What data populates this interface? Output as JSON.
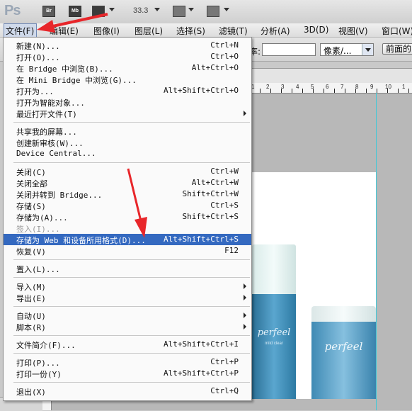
{
  "app": {
    "logo": "Ps",
    "toolbar": {
      "br_label": "Br",
      "mb_label": "Mb",
      "zoom": "33.3"
    }
  },
  "menubar": [
    "文件(F)",
    "编辑(E)",
    "图像(I)",
    "图层(L)",
    "选择(S)",
    "滤镜(T)",
    "分析(A)",
    "3D(D)",
    "视图(V)",
    "窗口(W)"
  ],
  "options_bar": {
    "label": "率:",
    "unit_select": "像素/...",
    "button": "前面的"
  },
  "ruler": [
    "1",
    "2",
    "3",
    "4",
    "5",
    "6",
    "7",
    "8",
    "9",
    "10",
    "1"
  ],
  "file_menu": [
    {
      "label": "新建(N)...",
      "shortcut": "Ctrl+N"
    },
    {
      "label": "打开(O)...",
      "shortcut": "Ctrl+O"
    },
    {
      "label": "在 Bridge 中浏览(B)...",
      "shortcut": "Alt+Ctrl+O"
    },
    {
      "label": "在 Mini Bridge 中浏览(G)...",
      "shortcut": ""
    },
    {
      "label": "打开为...",
      "shortcut": "Alt+Shift+Ctrl+O"
    },
    {
      "label": "打开为智能对象...",
      "shortcut": ""
    },
    {
      "label": "最近打开文件(T)",
      "shortcut": "",
      "submenu": true
    },
    {
      "separator": true
    },
    {
      "label": "共享我的屏幕...",
      "shortcut": ""
    },
    {
      "label": "创建新审核(W)...",
      "shortcut": ""
    },
    {
      "label": "Device Central...",
      "shortcut": ""
    },
    {
      "separator": true
    },
    {
      "label": "关闭(C)",
      "shortcut": "Ctrl+W"
    },
    {
      "label": "关闭全部",
      "shortcut": "Alt+Ctrl+W"
    },
    {
      "label": "关闭并转到 Bridge...",
      "shortcut": "Shift+Ctrl+W"
    },
    {
      "label": "存储(S)",
      "shortcut": "Ctrl+S"
    },
    {
      "label": "存储为(A)...",
      "shortcut": "Shift+Ctrl+S"
    },
    {
      "label": "签入(I)...",
      "shortcut": "",
      "disabled": true
    },
    {
      "label": "存储为 Web 和设备所用格式(D)...",
      "shortcut": "Alt+Shift+Ctrl+S",
      "highlight": true
    },
    {
      "label": "恢复(V)",
      "shortcut": "F12"
    },
    {
      "separator": true
    },
    {
      "label": "置入(L)...",
      "shortcut": ""
    },
    {
      "separator": true
    },
    {
      "label": "导入(M)",
      "shortcut": "",
      "submenu": true
    },
    {
      "label": "导出(E)",
      "shortcut": "",
      "submenu": true
    },
    {
      "separator": true
    },
    {
      "label": "自动(U)",
      "shortcut": "",
      "submenu": true
    },
    {
      "label": "脚本(R)",
      "shortcut": "",
      "submenu": true
    },
    {
      "separator": true
    },
    {
      "label": "文件简介(F)...",
      "shortcut": "Alt+Shift+Ctrl+I"
    },
    {
      "separator": true
    },
    {
      "label": "打印(P)...",
      "shortcut": "Ctrl+P"
    },
    {
      "label": "打印一份(Y)",
      "shortcut": "Alt+Shift+Ctrl+P"
    },
    {
      "separator": true
    },
    {
      "label": "退出(X)",
      "shortcut": "Ctrl+Q"
    }
  ],
  "canvas": {
    "bottle_brand_1": "perfeel",
    "bottle_sub_1": "mild clear",
    "bottle_brand_2": "perfeel"
  },
  "colors": {
    "highlight": "#3469c0",
    "annotation_arrow": "#e8262a",
    "guide": "#3ec8d8"
  }
}
